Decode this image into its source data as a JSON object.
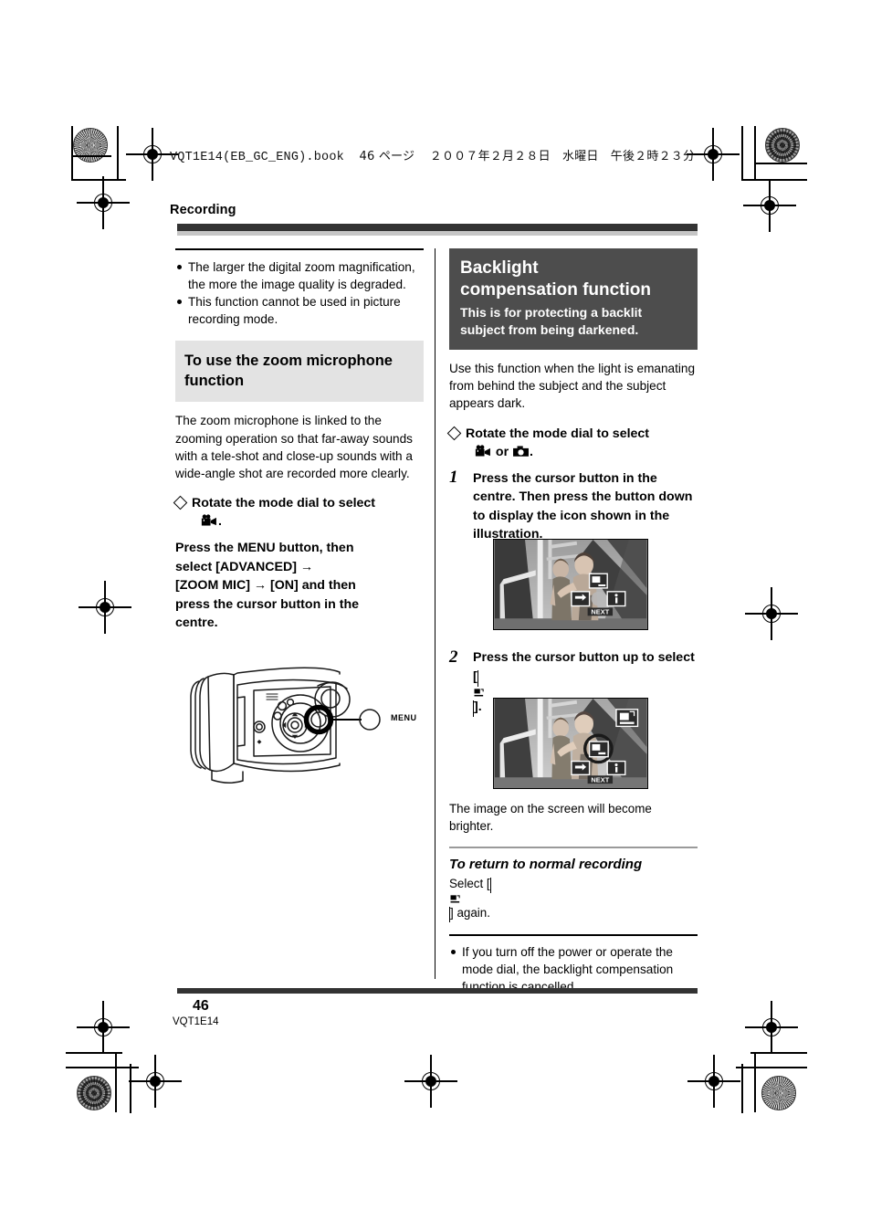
{
  "print": {
    "book_line": "VQT1E14(EB_GC_ENG).book",
    "book_page": "46 ページ",
    "book_date": "２００７年２月２８日　水曜日　午後２時２３分"
  },
  "header": {
    "chapter": "Recording"
  },
  "left_column": {
    "bullets": [
      "The larger the digital zoom magnification, the more the image quality is degraded.",
      "This function cannot be used in picture recording mode."
    ],
    "section_heading": "To use the zoom microphone function",
    "intro": "The zoom microphone is linked to the zooming operation so that far-away sounds with a tele-shot and close-up sounds with a wide-angle shot are recorded more clearly.",
    "dial_instruction_pre": "Rotate the mode dial to select",
    "dial_instruction_post": ".",
    "menu_instruction_1": "Press the MENU button, then",
    "menu_instruction_2": "select [ADVANCED] →",
    "menu_instruction_3": "[ZOOM MIC] → [ON] and then",
    "menu_instruction_4": "press the cursor button in the",
    "menu_instruction_5": "centre.",
    "illustration_label": "MENU"
  },
  "right_column": {
    "title_line1": "Backlight",
    "title_line2": "compensation function",
    "subtitle": "This is for protecting a backlit subject from being darkened.",
    "intro": "Use this function when the light is emanating from behind the subject and the subject appears dark.",
    "dial_instruction_pre": "Rotate the mode dial to select",
    "dial_instruction_or": "or",
    "dial_instruction_post": ".",
    "steps": [
      {
        "num": "1",
        "text": "Press the cursor button in the centre. Then press the button down to display the icon shown in the illustration."
      },
      {
        "num": "2",
        "text_pre": "Press the cursor button up to select [",
        "text_post": "]."
      }
    ],
    "step2_caption": "The image on the screen will become brighter.",
    "return_heading": "To return to normal recording",
    "return_text_pre": "Select [",
    "return_text_post": "] again.",
    "final_bullet": "If you turn off the power or operate the mode dial, the backlight compensation function is cancelled."
  },
  "osd": {
    "next_label": "NEXT"
  },
  "footer": {
    "page_number": "46",
    "code": "VQT1E14"
  },
  "colors": {
    "header_box": "#4d4d4d",
    "shaded_heading": "#e3e3e3",
    "rule_dark": "#333333",
    "rule_light": "#c6c6c6"
  }
}
